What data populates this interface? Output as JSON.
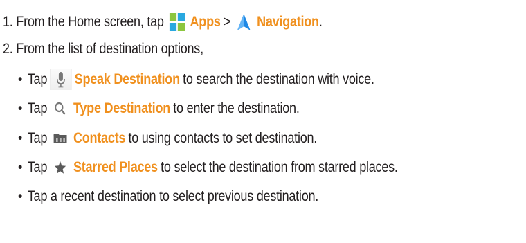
{
  "steps": {
    "step1": {
      "text_before": "1. From the Home screen, tap",
      "apps_label": "Apps",
      "separator": ">",
      "navigation_label": "Navigation",
      "end": "."
    },
    "step2": {
      "text": "2. From the list of destination options,"
    },
    "bullets": [
      {
        "prefix": "Tap",
        "icon": "microphone-icon",
        "label": "Speak Destination",
        "text": "to search the destination with voice."
      },
      {
        "prefix": "Tap",
        "icon": "search-icon",
        "label": "Type Destination",
        "text": "to enter the destination."
      },
      {
        "prefix": "Tap",
        "icon": "contacts-icon",
        "label": "Contacts",
        "text": "to using contacts to set destination."
      },
      {
        "prefix": "Tap",
        "icon": "star-icon",
        "label": "Starred Places",
        "text": "to select the destination from starred places."
      },
      {
        "text": "Tap a recent destination to select previous destination."
      }
    ],
    "bullet_symbol": "•"
  },
  "colors": {
    "body_text": "#231f20",
    "highlight": "#f0901e",
    "apps_icon_green": "#8cc63f",
    "apps_icon_blue": "#29a8e0",
    "navigation_icon": "#1e88e5"
  }
}
